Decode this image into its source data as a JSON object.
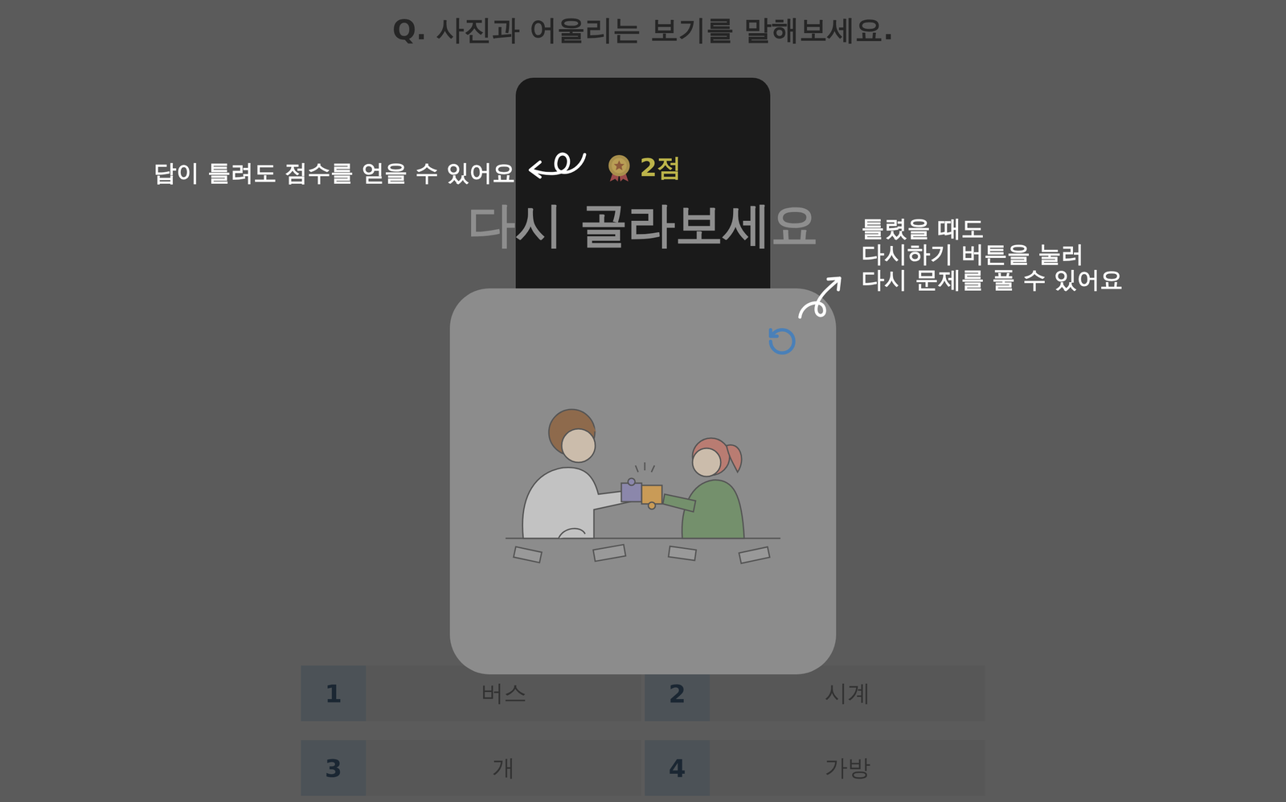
{
  "question": {
    "text": "Q. 사진과 어울리는 보기를 말해보세요."
  },
  "score": {
    "text": "2점"
  },
  "feedback": {
    "text": "다시 골라보세요"
  },
  "choices": [
    {
      "number": "1",
      "label": "버스"
    },
    {
      "number": "2",
      "label": "시계"
    },
    {
      "number": "3",
      "label": "개"
    },
    {
      "number": "4",
      "label": "가방"
    }
  ],
  "tips": [
    {
      "kind": "score",
      "lines": [
        "답이 틀려도 점수를 얻을 수 있어요"
      ]
    },
    {
      "kind": "retry",
      "lines": [
        "틀렸을 때도",
        "다시하기 버튼을 눌러",
        "다시 문제를 풀 수 있어요"
      ]
    }
  ]
}
